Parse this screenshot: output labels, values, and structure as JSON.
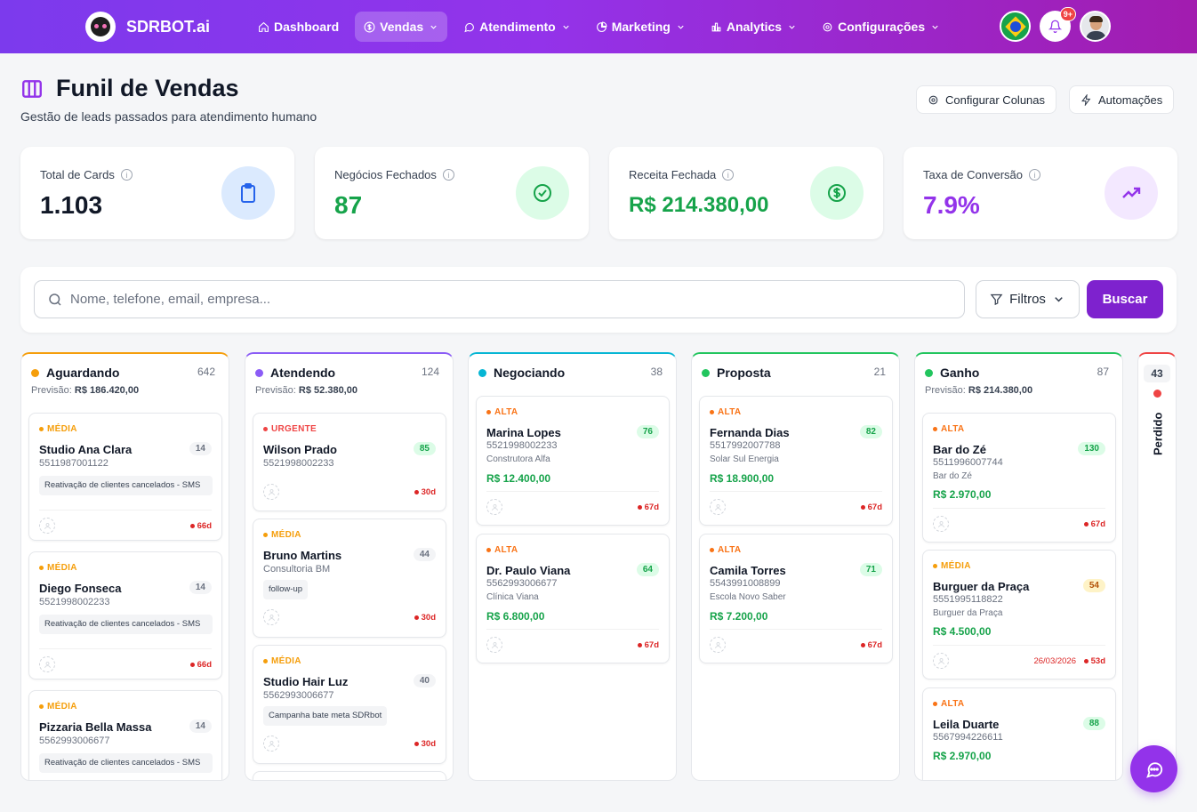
{
  "brand": {
    "name": "SDRBOT.ai"
  },
  "nav": [
    {
      "label": "Dashboard",
      "icon": "home-icon",
      "active": false,
      "dropdown": false
    },
    {
      "label": "Vendas",
      "icon": "dollar-icon",
      "active": true,
      "dropdown": true
    },
    {
      "label": "Atendimento",
      "icon": "chat-icon",
      "active": false,
      "dropdown": true
    },
    {
      "label": "Marketing",
      "icon": "pie-icon",
      "active": false,
      "dropdown": true
    },
    {
      "label": "Analytics",
      "icon": "bar-chart-icon",
      "active": false,
      "dropdown": true
    },
    {
      "label": "Configurações",
      "icon": "gear-icon",
      "active": false,
      "dropdown": true
    }
  ],
  "notifications": {
    "badge": "9+"
  },
  "page": {
    "title": "Funil de Vendas",
    "subtitle": "Gestão de leads passados para atendimento humano",
    "configure_columns": "Configurar Colunas",
    "automations": "Automações"
  },
  "stats": [
    {
      "label": "Total de Cards",
      "value": "1.103",
      "color": "#111827",
      "icon": "clipboard-icon",
      "icon_bg": "#dbeafe",
      "icon_color": "#2563eb"
    },
    {
      "label": "Negócios Fechados",
      "value": "87",
      "color": "#16a34a",
      "icon": "check-circle-icon",
      "icon_bg": "#dcfce7",
      "icon_color": "#16a34a"
    },
    {
      "label": "Receita Fechada",
      "value": "R$ 214.380,00",
      "color": "#16a34a",
      "icon": "dollar-circle-icon",
      "icon_bg": "#dcfce7",
      "icon_color": "#16a34a"
    },
    {
      "label": "Taxa de Conversão",
      "value": "7.9%",
      "color": "#9333ea",
      "icon": "trending-up-icon",
      "icon_bg": "#f3e8ff",
      "icon_color": "#9333ea"
    }
  ],
  "search": {
    "placeholder": "Nome, telefone, email, empresa...",
    "filters_label": "Filtros",
    "search_label": "Buscar"
  },
  "columns": [
    {
      "name": "Aguardando",
      "count": "642",
      "color": "#f59e0b",
      "forecast_label": "Previsão:",
      "forecast": "R$ 186.420,00",
      "cards": [
        {
          "priority": "MÉDIA",
          "name": "Studio Ana Clara",
          "phone": "5511987001122",
          "score": "14",
          "tag": "Reativação de clientes cancelados - SMS",
          "age": "66d"
        },
        {
          "priority": "MÉDIA",
          "name": "Diego Fonseca",
          "phone": "5521998002233",
          "score": "14",
          "tag": "Reativação de clientes cancelados - SMS",
          "age": "66d"
        },
        {
          "priority": "MÉDIA",
          "name": "Pizzaria Bella Massa",
          "phone": "5562993006677",
          "score": "14",
          "tag": "Reativação de clientes cancelados - SMS",
          "age": ""
        }
      ]
    },
    {
      "name": "Atendendo",
      "count": "124",
      "color": "#8b5cf6",
      "forecast_label": "Previsão:",
      "forecast": "R$ 52.380,00",
      "cards": [
        {
          "priority": "URGENTE",
          "name": "Wilson Prado",
          "phone": "5521998002233",
          "score": "85",
          "age": "30d"
        },
        {
          "priority": "MÉDIA",
          "name": "Bruno Martins",
          "phone": "Consultoria BM",
          "score": "44",
          "tag": "follow-up",
          "age": "30d"
        },
        {
          "priority": "MÉDIA",
          "name": "Studio Hair Luz",
          "phone": "5562993006677",
          "score": "40",
          "tag": "Campanha bate meta SDRbot",
          "age": "30d"
        }
      ]
    },
    {
      "name": "Negociando",
      "count": "38",
      "color": "#06b6d4",
      "cards": [
        {
          "priority": "ALTA",
          "name": "Marina Lopes",
          "phone": "5521998002233",
          "company": "Construtora Alfa",
          "value": "R$ 12.400,00",
          "score": "76",
          "age": "67d"
        },
        {
          "priority": "ALTA",
          "name": "Dr. Paulo Viana",
          "phone": "5562993006677",
          "company": "Clínica Viana",
          "value": "R$ 6.800,00",
          "score": "64",
          "age": "67d"
        }
      ]
    },
    {
      "name": "Proposta",
      "count": "21",
      "color": "#22c55e",
      "cards": [
        {
          "priority": "ALTA",
          "name": "Fernanda Dias",
          "phone": "5517992007788",
          "company": "Solar Sul Energia",
          "value": "R$ 18.900,00",
          "score": "82",
          "age": "67d"
        },
        {
          "priority": "ALTA",
          "name": "Camila Torres",
          "phone": "5543991008899",
          "company": "Escola Novo Saber",
          "value": "R$ 7.200,00",
          "score": "71",
          "age": "67d"
        }
      ]
    },
    {
      "name": "Ganho",
      "count": "87",
      "color": "#22c55e",
      "forecast_label": "Previsão:",
      "forecast": "R$ 214.380,00",
      "cards": [
        {
          "priority": "ALTA",
          "name": "Bar do Zé",
          "phone": "5511996007744",
          "company": "Bar do Zé",
          "value": "R$ 2.970,00",
          "score": "130",
          "age": "67d"
        },
        {
          "priority": "MÉDIA",
          "name": "Burguer da Praça",
          "phone": "5551995118822",
          "company": "Burguer da Praça",
          "value": "R$ 4.500,00",
          "score": "54",
          "due": "26/03/2026",
          "age": "53d"
        },
        {
          "priority": "ALTA",
          "name": "Leila Duarte",
          "phone": "5567994226611",
          "value": "R$ 2.970,00",
          "score": "88",
          "age": ""
        }
      ]
    }
  ],
  "lost_column": {
    "name": "Perdido",
    "count": "43",
    "color": "#ef4444"
  },
  "colors": {
    "priority_media": "#f59e0b",
    "priority_alta": "#f97316",
    "priority_urgente": "#ef4444",
    "accent": "#7e22ce"
  }
}
